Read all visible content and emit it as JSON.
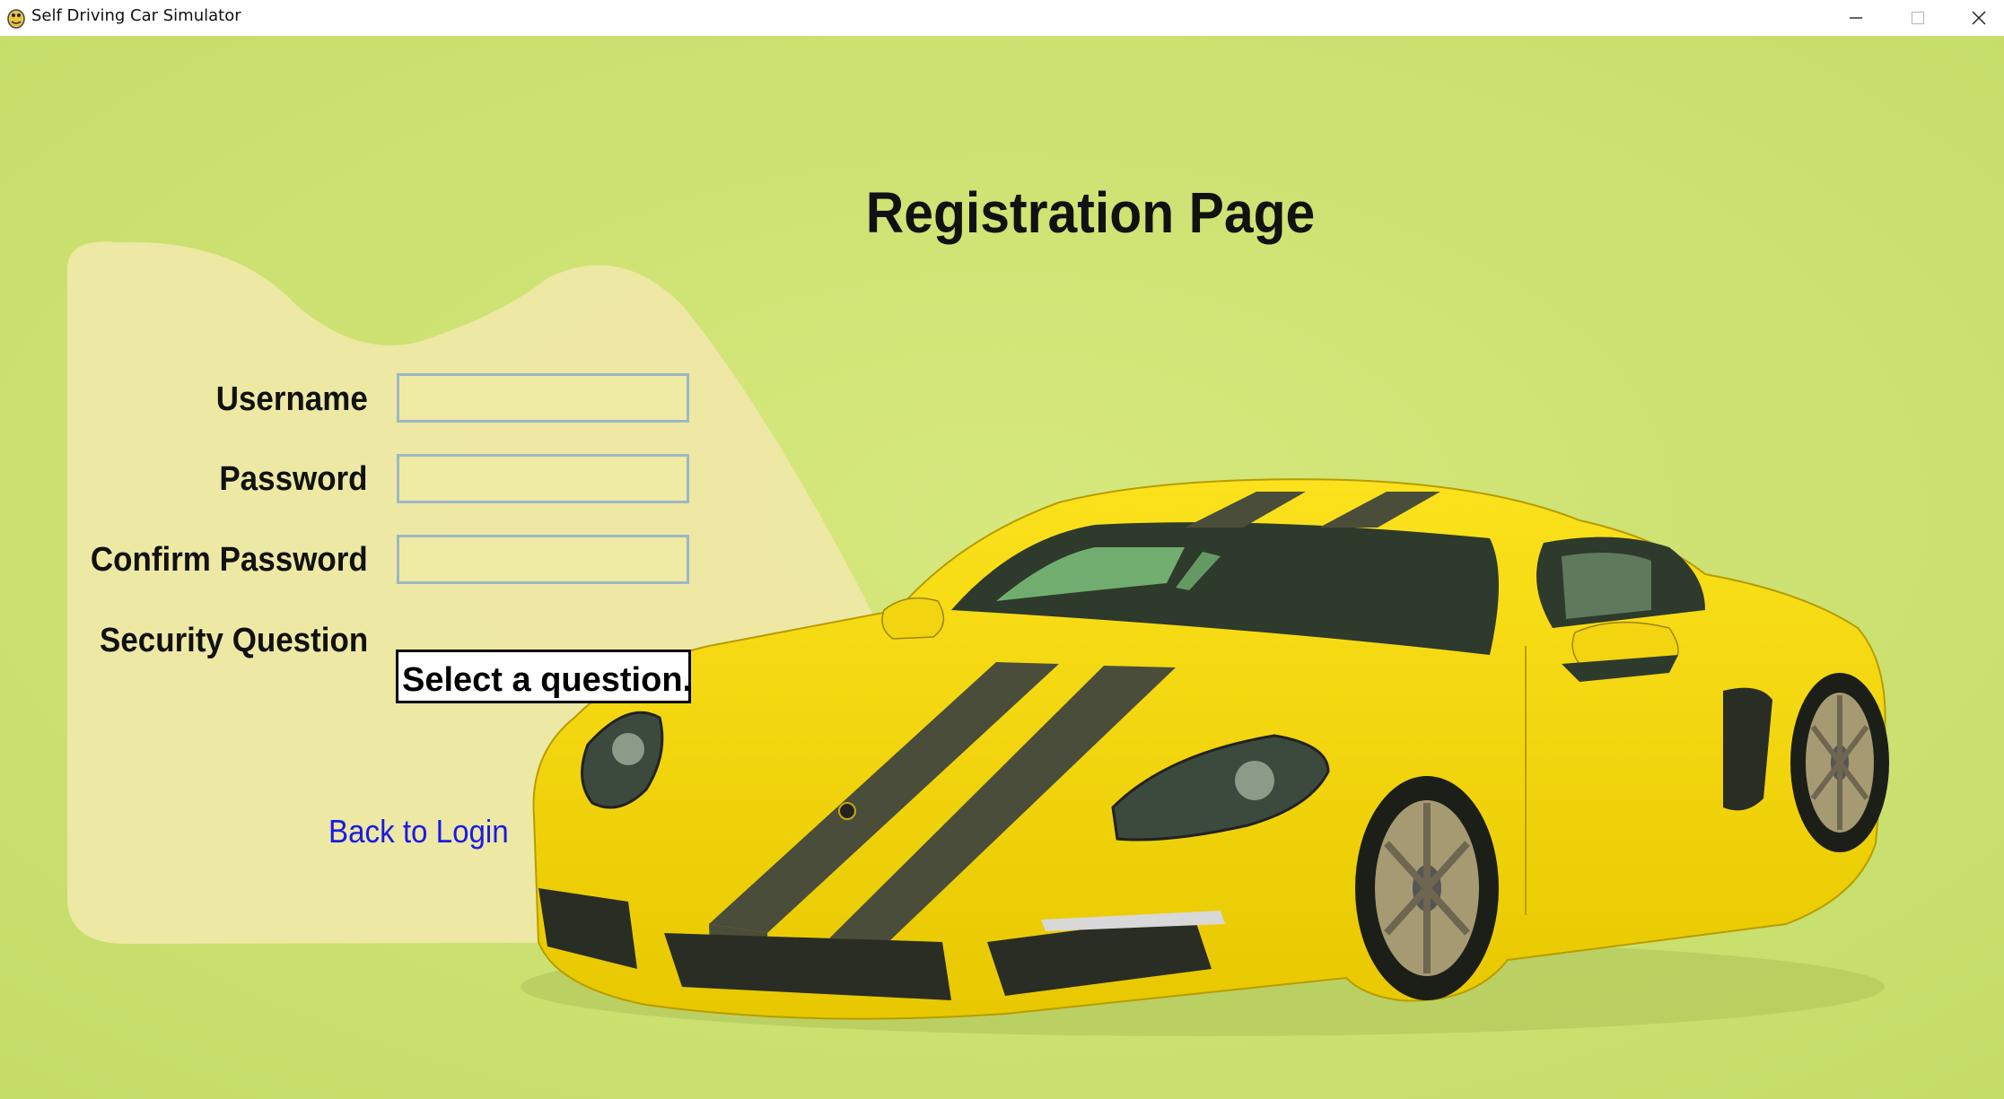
{
  "window": {
    "title": "Self Driving Car Simulator",
    "app_icon": "pygame-snake-icon",
    "controls": [
      "minimize-icon",
      "maximize-icon",
      "close-icon"
    ]
  },
  "page": {
    "heading": "Registration Page"
  },
  "form": {
    "username_label": "Username",
    "username_value": "",
    "password_label": "Password",
    "password_value": "",
    "confirm_label": "Confirm Password",
    "confirm_value": "",
    "security_label": "Security Question",
    "security_selected": "Select a question...",
    "back_link": "Back to Login"
  },
  "colors": {
    "background": "#cfe277",
    "panel": "#f0e8a8",
    "car_body": "#f5d80a",
    "stripe": "#4a4d3a",
    "link": "#1a1ae6",
    "input_border": "#9cb8c6"
  }
}
